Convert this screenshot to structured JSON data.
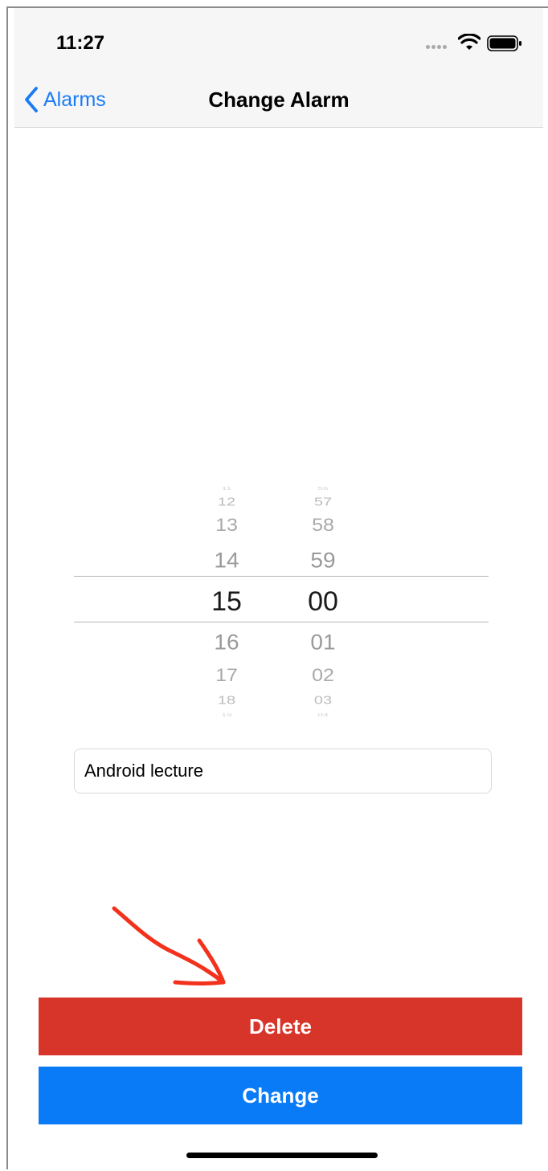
{
  "status_bar": {
    "time": "11:27",
    "icons": [
      "signal-dots-icon",
      "wifi-icon",
      "battery-icon"
    ]
  },
  "navbar": {
    "back_label": "Alarms",
    "title": "Change Alarm"
  },
  "picker": {
    "hours": [
      "11",
      "12",
      "13",
      "14",
      "15",
      "16",
      "17",
      "18",
      "19"
    ],
    "minutes": [
      "56",
      "57",
      "58",
      "59",
      "00",
      "01",
      "02",
      "03",
      "04"
    ],
    "selected_hour": "15",
    "selected_minute": "00"
  },
  "alarm_label": {
    "value": "Android lecture"
  },
  "buttons": {
    "delete": "Delete",
    "change": "Change"
  },
  "colors": {
    "accent": "#1a7cf5",
    "delete": "#d8352a",
    "change": "#0a7bf6",
    "annotation": "#f2321c"
  }
}
